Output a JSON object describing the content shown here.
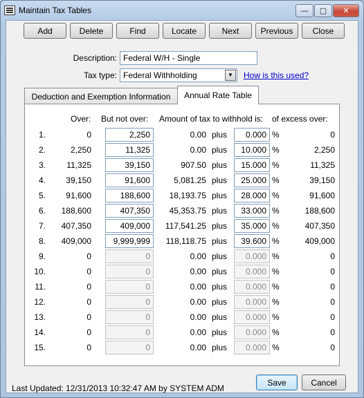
{
  "window": {
    "title": "Maintain Tax Tables",
    "minimize_glyph": "—",
    "maximize_glyph": "▢",
    "close_glyph": "✕"
  },
  "toolbar": {
    "add": "Add",
    "delete": "Delete",
    "find": "Find",
    "locate": "Locate",
    "next": "Next",
    "previous": "Previous",
    "close": "Close"
  },
  "form": {
    "description_label": "Description:",
    "description_value": "Federal W/H - Single",
    "tax_type_label": "Tax type:",
    "tax_type_value": "Federal Withholding",
    "how_link": "How is this used?"
  },
  "tabs": [
    {
      "label": "Deduction and Exemption Information",
      "active": false
    },
    {
      "label": "Annual Rate Table",
      "active": true
    }
  ],
  "rate_table": {
    "headers": {
      "over": "Over:",
      "but_not_over": "But not over:",
      "amount": "Amount of tax to withhold is:",
      "excess": "of excess over:"
    },
    "plus_word": "plus",
    "percent_sign": "%",
    "rows": [
      {
        "n": "1.",
        "over": "0",
        "but_not_over": "2,250",
        "amount": "0.00",
        "rate": "0.000",
        "excess": "0",
        "enabled": true
      },
      {
        "n": "2.",
        "over": "2,250",
        "but_not_over": "11,325",
        "amount": "0.00",
        "rate": "10.000",
        "excess": "2,250",
        "enabled": true
      },
      {
        "n": "3.",
        "over": "11,325",
        "but_not_over": "39,150",
        "amount": "907.50",
        "rate": "15.000",
        "excess": "11,325",
        "enabled": true
      },
      {
        "n": "4.",
        "over": "39,150",
        "but_not_over": "91,600",
        "amount": "5,081.25",
        "rate": "25.000",
        "excess": "39,150",
        "enabled": true
      },
      {
        "n": "5.",
        "over": "91,600",
        "but_not_over": "188,600",
        "amount": "18,193.75",
        "rate": "28.000",
        "excess": "91,600",
        "enabled": true
      },
      {
        "n": "6.",
        "over": "188,600",
        "but_not_over": "407,350",
        "amount": "45,353.75",
        "rate": "33.000",
        "excess": "188,600",
        "enabled": true
      },
      {
        "n": "7.",
        "over": "407,350",
        "but_not_over": "409,000",
        "amount": "117,541.25",
        "rate": "35.000",
        "excess": "407,350",
        "enabled": true
      },
      {
        "n": "8.",
        "over": "409,000",
        "but_not_over": "9,999,999",
        "amount": "118,118.75",
        "rate": "39.600",
        "excess": "409,000",
        "enabled": true
      },
      {
        "n": "9.",
        "over": "0",
        "but_not_over": "0",
        "amount": "0.00",
        "rate": "0.000",
        "excess": "0",
        "enabled": false
      },
      {
        "n": "10.",
        "over": "0",
        "but_not_over": "0",
        "amount": "0.00",
        "rate": "0.000",
        "excess": "0",
        "enabled": false
      },
      {
        "n": "11.",
        "over": "0",
        "but_not_over": "0",
        "amount": "0.00",
        "rate": "0.000",
        "excess": "0",
        "enabled": false
      },
      {
        "n": "12.",
        "over": "0",
        "but_not_over": "0",
        "amount": "0.00",
        "rate": "0.000",
        "excess": "0",
        "enabled": false
      },
      {
        "n": "13.",
        "over": "0",
        "but_not_over": "0",
        "amount": "0.00",
        "rate": "0.000",
        "excess": "0",
        "enabled": false
      },
      {
        "n": "14.",
        "over": "0",
        "but_not_over": "0",
        "amount": "0.00",
        "rate": "0.000",
        "excess": "0",
        "enabled": false
      },
      {
        "n": "15.",
        "over": "0",
        "but_not_over": "0",
        "amount": "0.00",
        "rate": "0.000",
        "excess": "0",
        "enabled": false
      }
    ]
  },
  "footer": {
    "last_updated": "Last Updated: 12/31/2013 10:32:47 AM by SYSTEM ADM",
    "save": "Save",
    "cancel": "Cancel"
  }
}
